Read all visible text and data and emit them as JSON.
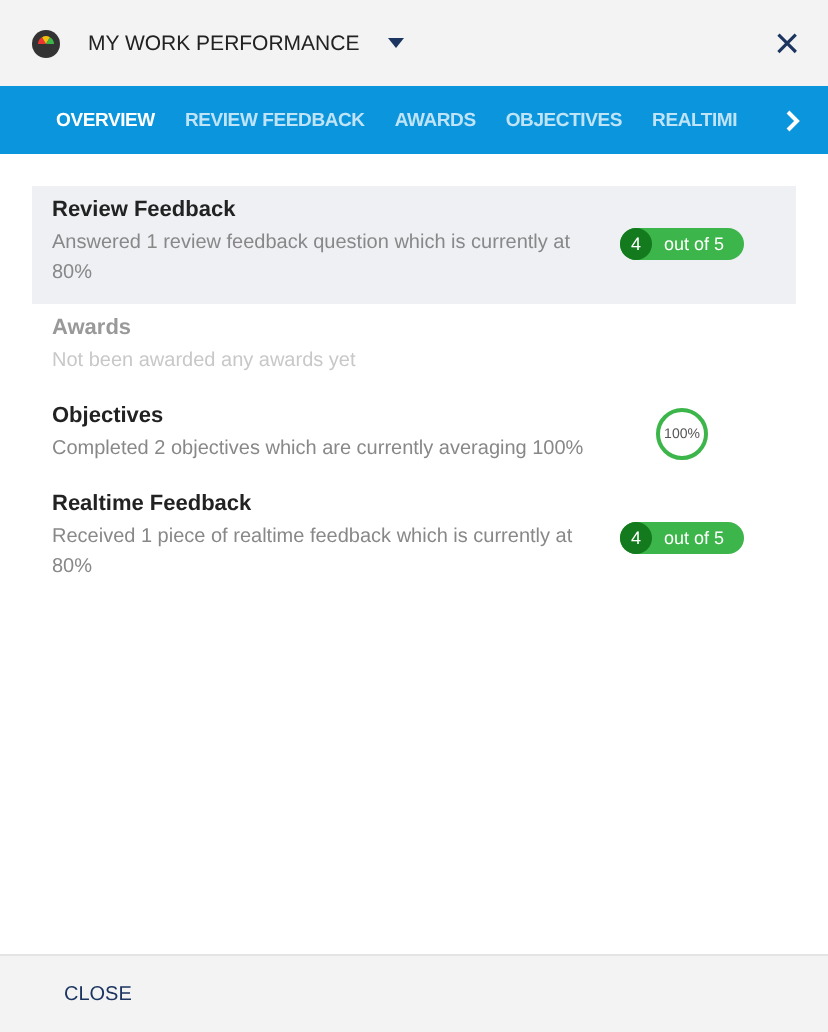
{
  "header": {
    "title": "MY WORK PERFORMANCE",
    "close": "×"
  },
  "tabs": [
    {
      "label": "OVERVIEW",
      "selected": true
    },
    {
      "label": "REVIEW FEEDBACK",
      "selected": false
    },
    {
      "label": "AWARDS",
      "selected": false
    },
    {
      "label": "OBJECTIVES",
      "selected": false
    },
    {
      "label": "REALTIMI",
      "selected": false
    }
  ],
  "rows": [
    {
      "title": "Review Feedback",
      "description": "Answered 1 review feedback question which is currently at 80%",
      "kind": "rating",
      "score": "4",
      "out_of": "out of 5",
      "selected": true,
      "disabled": false
    },
    {
      "title": "Awards",
      "description": "Not been awarded any awards yet",
      "kind": "none",
      "selected": false,
      "disabled": true
    },
    {
      "title": "Objectives",
      "description": "Completed 2 objectives which are currently averaging 100%",
      "kind": "percent",
      "percent": "100%",
      "selected": false,
      "disabled": false
    },
    {
      "title": "Realtime Feedback",
      "description": "Received 1 piece of realtime feedback which is currently at 80%",
      "kind": "rating",
      "score": "4",
      "out_of": "out of 5",
      "selected": false,
      "disabled": false
    }
  ],
  "footer": {
    "button": "CLOSE"
  }
}
